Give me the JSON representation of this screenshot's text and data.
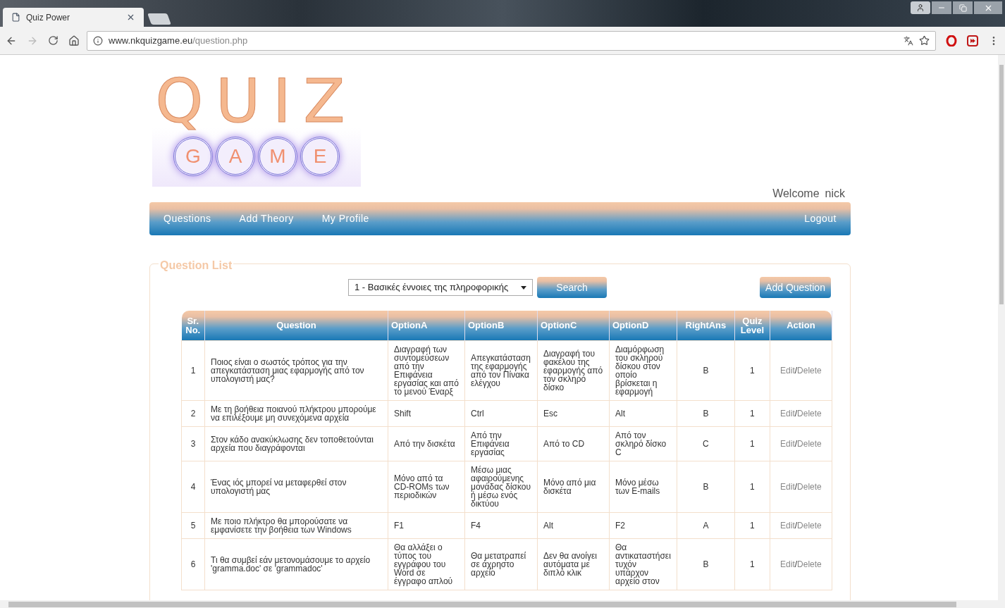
{
  "browser": {
    "tab_title": "Quiz Power",
    "url_host": "www.nkquizgame.eu",
    "url_path": "/question.php"
  },
  "logo": {
    "title": "QUIZ",
    "letters": [
      "G",
      "A",
      "M",
      "E"
    ]
  },
  "welcome": {
    "label": "Welcome",
    "user": "nick"
  },
  "nav": {
    "items": [
      "Questions",
      "Add Theory",
      "My Profile"
    ],
    "logout": "Logout"
  },
  "panel": {
    "legend": "Question List",
    "filter": {
      "value": "1 - Βασικές έννοιες της πληροφορικής"
    },
    "search_button": "Search",
    "add_button": "Add Question"
  },
  "table": {
    "columns": [
      "Sr. No.",
      "Question",
      "OptionA",
      "OptionB",
      "OptionC",
      "OptionD",
      "RightAns",
      "Quiz Level",
      "Action"
    ],
    "rows": [
      {
        "cells": [
          "1",
          "Ποιος είναι ο σωστός τρόπος για την απεγκατάσταση μιας εφαρμογής από τον υπολογιστή μας?",
          "Διαγραφή των συντομεύσεων από την Επιφάνεια εργασίας και από το μενού Έναρξ",
          "Απεγκατάσταση της εφαρμογής από τον Πίνακα ελέγχου",
          "Διαγραφή του φακέλου της εφαρμογής από τον σκληρό δίσκο",
          "Διαμόρφωση του σκληρού δίσκου στον οποίο βρίσκεται η εφαρμογή",
          "B",
          "1"
        ],
        "edit": "Edit",
        "sep": "/",
        "delete": "Delete"
      },
      {
        "cells": [
          "2",
          "Με τη βοήθεια ποιανού πλήκτρου μπορούμε να επιλέξουμε μη συνεχόμενα αρχεία",
          "Shift",
          "Ctrl",
          "Esc",
          "Alt",
          "B",
          "1"
        ],
        "edit": "Edit",
        "sep": "/",
        "delete": "Delete"
      },
      {
        "cells": [
          "3",
          "Στον κάδο ανακύκλωσης δεν τοποθετούνται αρχεία που διαγράφονται",
          "Από την δισκέτα",
          "Από την Επιφάνεια εργασίας",
          "Από το CD",
          "Από τον σκληρό δίσκο C",
          "C",
          "1"
        ],
        "edit": "Edit",
        "sep": "/",
        "delete": "Delete"
      },
      {
        "cells": [
          "4",
          "Ένας ιός μπορεί να μεταφερθεί στον υπολογιστή μας",
          "Μόνο από τα CD-ROMs των περιοδικών",
          "Μέσω μιας αφαιρούμενης μονάδας δίσκου ή μέσω ενός δικτύου",
          "Μόνο από μια δισκέτα",
          "Μόνο μέσω των E-mails",
          "B",
          "1"
        ],
        "edit": "Edit",
        "sep": "/",
        "delete": "Delete"
      },
      {
        "cells": [
          "5",
          "Με ποιο πλήκτρο θα μπορούσατε να εμφανίσετε την βοήθεια των Windows",
          "F1",
          "F4",
          "Alt",
          "F2",
          "A",
          "1"
        ],
        "edit": "Edit",
        "sep": "/",
        "delete": "Delete"
      },
      {
        "cells": [
          "6",
          "Τι θα συμβεί εάν μετονομάσουμε το αρχείο 'gramma.doc' σε 'grammadoc'",
          "Θα αλλάξει ο τύπος του εγγράφου του Word σε έγγραφο απλού",
          "Θα μετατραπεί σε άχρηστο αρχείο",
          "Δεν θα ανοίγει αυτόματα με διπλό κλικ",
          "Θα αντικαταστήσει τυχόν υπάρχον αρχείο στον",
          "B",
          "1"
        ],
        "edit": "Edit",
        "sep": "/",
        "delete": "Delete"
      }
    ]
  }
}
